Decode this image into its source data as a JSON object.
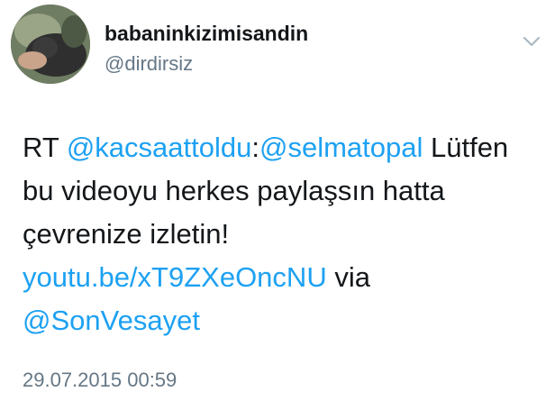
{
  "user": {
    "display_name": "babaninkizimisandin",
    "handle": "@dirdirsiz"
  },
  "tweet": {
    "line1": {
      "rt": "RT ",
      "mention1": "@kacsaattoldu",
      "colon": ":",
      "mention2": "@selmatopal",
      "rest": " Lütfen"
    },
    "line2": "bu videoyu herkes paylaşsın hatta",
    "line3": "çevrenize izletin!",
    "line4": {
      "url": "youtu.be/xT9ZXeOncNU",
      "via": " via"
    },
    "line5": {
      "mention": "@SonVesayet"
    }
  },
  "timestamp": "29.07.2015 00:59",
  "icons": {
    "menu": "chevron-down-icon"
  },
  "colors": {
    "link": "#1da1f2",
    "secondary_text": "#657786",
    "primary_text": "#14171a"
  }
}
